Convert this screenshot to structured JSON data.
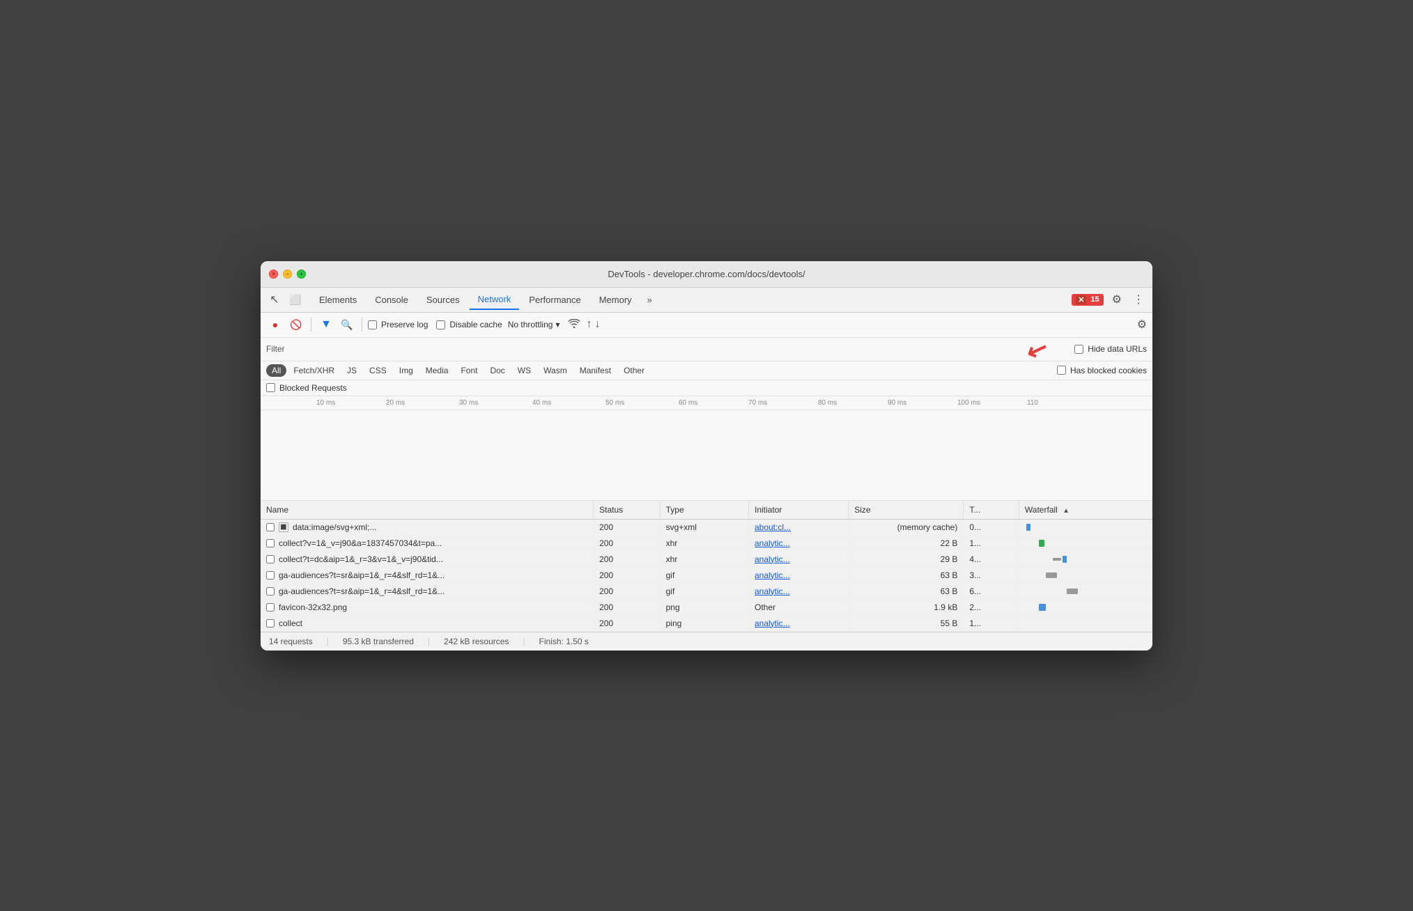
{
  "window": {
    "title": "DevTools - developer.chrome.com/docs/devtools/"
  },
  "titlebar": {
    "traffic_lights": [
      "close",
      "minimize",
      "maximize"
    ],
    "title": "DevTools - developer.chrome.com/docs/devtools/"
  },
  "tabs": {
    "items": [
      "Elements",
      "Console",
      "Sources",
      "Network",
      "Performance",
      "Memory"
    ],
    "active": "Network",
    "more": "»",
    "error_count": "15",
    "gear_label": "⚙",
    "dots_label": "⋮"
  },
  "toolbar": {
    "record_label": "●",
    "clear_label": "🚫",
    "filter_icon": "▼",
    "search_icon": "🔍",
    "preserve_log_label": "Preserve log",
    "disable_cache_label": "Disable cache",
    "throttle_label": "No throttling",
    "throttle_arrow": "▾",
    "wifi_icon": "wifi",
    "upload_icon": "↑",
    "download_icon": "↓",
    "settings_icon": "⚙"
  },
  "filter_bar": {
    "filter_label": "Filter",
    "hide_data_urls_label": "Hide data URLs"
  },
  "filter_types": {
    "buttons": [
      "All",
      "Fetch/XHR",
      "JS",
      "CSS",
      "Img",
      "Media",
      "Font",
      "Doc",
      "WS",
      "Wasm",
      "Manifest",
      "Other"
    ],
    "active": "All",
    "has_blocked_cookies_label": "Has blocked cookies"
  },
  "blocked_requests": {
    "label": "Blocked Requests"
  },
  "timeline": {
    "ticks": [
      "10 ms",
      "20 ms",
      "30 ms",
      "40 ms",
      "50 ms",
      "60 ms",
      "70 ms",
      "80 ms",
      "90 ms",
      "100 ms",
      "110"
    ]
  },
  "table": {
    "columns": [
      "Name",
      "Status",
      "Type",
      "Initiator",
      "Size",
      "T...",
      "Waterfall"
    ],
    "rows": [
      {
        "name": "data:image/svg+xml;...",
        "status": "200",
        "type": "svg+xml",
        "initiator": "about:cl...",
        "size": "(memory cache)",
        "time": "0...",
        "waterfall": "blue",
        "has_icon": true
      },
      {
        "name": "collect?v=1&_v=j90&a=1837457034&t=pa...",
        "status": "200",
        "type": "xhr",
        "initiator": "analytic...",
        "size": "22 B",
        "time": "1...",
        "waterfall": "green"
      },
      {
        "name": "collect?t=dc&aip=1&_r=3&v=1&_v=j90&tid...",
        "status": "200",
        "type": "xhr",
        "initiator": "analytic...",
        "size": "29 B",
        "time": "4...",
        "waterfall": "gray2"
      },
      {
        "name": "ga-audiences?t=sr&aip=1&_r=4&slf_rd=1&...",
        "status": "200",
        "type": "gif",
        "initiator": "analytic...",
        "size": "63 B",
        "time": "3...",
        "waterfall": "gray"
      },
      {
        "name": "ga-audiences?t=sr&aip=1&_r=4&slf_rd=1&...",
        "status": "200",
        "type": "gif",
        "initiator": "analytic...",
        "size": "63 B",
        "time": "6...",
        "waterfall": "gray3"
      },
      {
        "name": "favicon-32x32.png",
        "status": "200",
        "type": "png",
        "initiator": "Other",
        "size": "1.9 kB",
        "time": "2...",
        "waterfall": "blue2"
      },
      {
        "name": "collect",
        "status": "200",
        "type": "ping",
        "initiator": "analytic...",
        "size": "55 B",
        "time": "1...",
        "waterfall": "none"
      }
    ]
  },
  "status_bar": {
    "requests": "14 requests",
    "transferred": "95.3 kB transferred",
    "resources": "242 kB resources",
    "finish": "Finish: 1.50 s"
  },
  "red_arrow": "↙"
}
